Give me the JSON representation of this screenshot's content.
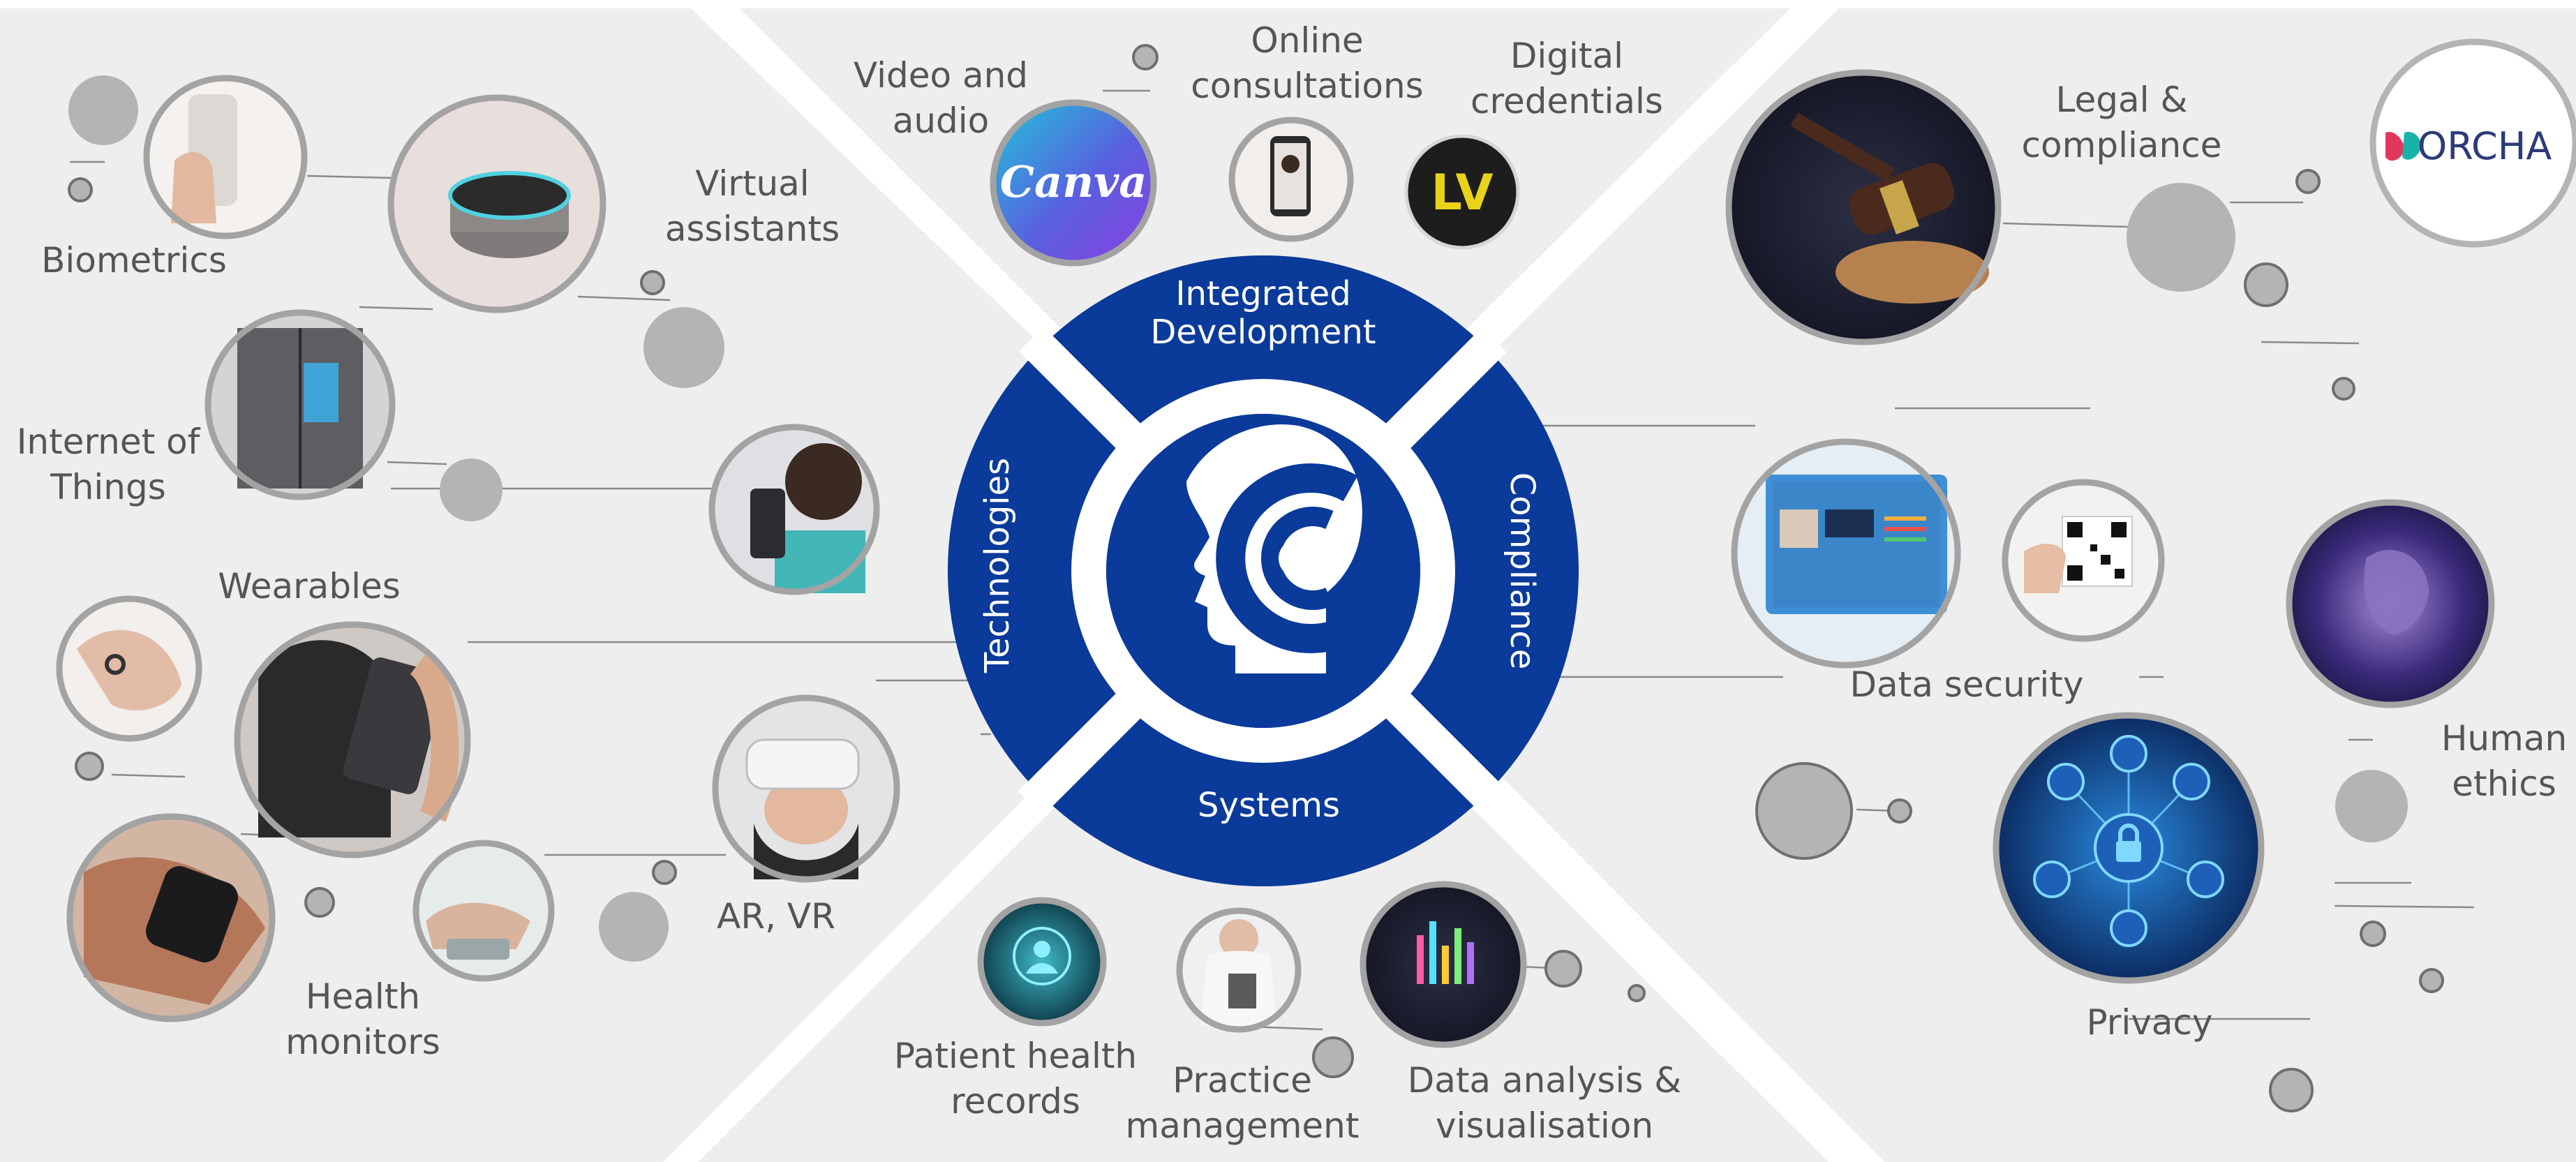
{
  "center": {
    "segments": {
      "top": "Integrated",
      "top2": "Development",
      "left": "Technologies",
      "right": "Compliance",
      "bottom": "Systems"
    },
    "colors": {
      "ring": "#0a3a9a",
      "panel": "#eeeeee",
      "gap": "#ffffff"
    }
  },
  "top": {
    "video_l1": "Video and",
    "video_l2": "audio",
    "online_l1": "Online",
    "online_l2": "consultations",
    "digital_l1": "Digital",
    "digital_l2": "credentials",
    "canva_logo": "Canva",
    "lv_logo": "LV"
  },
  "left": {
    "biometrics": "Biometrics",
    "virtual_l1": "Virtual",
    "virtual_l2": "assistants",
    "iot_l1": "Internet of",
    "iot_l2": "Things",
    "wearables": "Wearables",
    "arvr": "AR, VR",
    "health_l1": "Health",
    "health_l2": "monitors"
  },
  "right": {
    "legal_l1": "Legal &",
    "legal_l2": "compliance",
    "orcha_logo": "ORCHA",
    "data_security": "Data security",
    "human_l1": "Human",
    "human_l2": "ethics",
    "privacy": "Privacy"
  },
  "bottom": {
    "patient_l1": "Patient health",
    "patient_l2": "records",
    "practice_l1": "Practice",
    "practice_l2": "management",
    "analysis_l1": "Data analysis &",
    "analysis_l2": "visualisation"
  }
}
